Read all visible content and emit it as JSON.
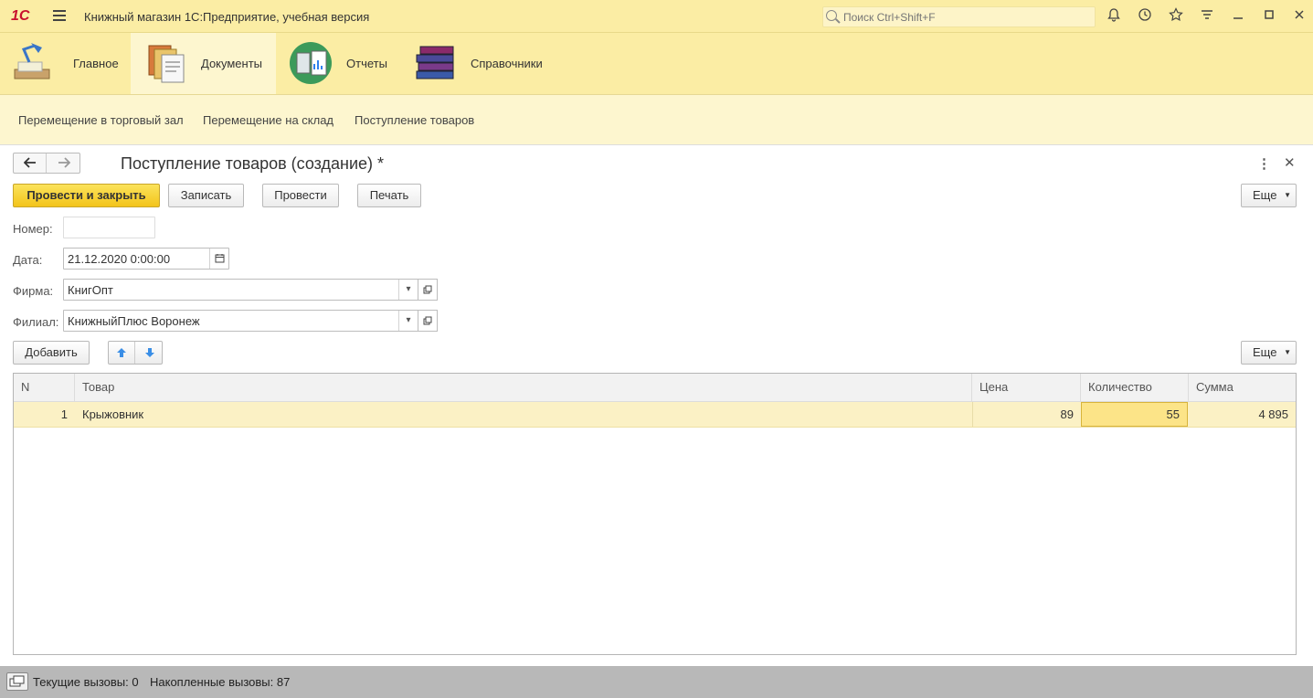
{
  "app": {
    "logo": "1С",
    "title": "Книжный магазин 1С:Предприятие, учебная версия",
    "search_placeholder": "Поиск Ctrl+Shift+F"
  },
  "sections": [
    {
      "label": "Главное",
      "icon": "desk-lamp-icon"
    },
    {
      "label": "Документы",
      "icon": "documents-icon",
      "active": true
    },
    {
      "label": "Отчеты",
      "icon": "reports-icon"
    },
    {
      "label": "Справочники",
      "icon": "books-icon"
    }
  ],
  "commands": [
    "Перемещение в торговый зал",
    "Перемещение на склад",
    "Поступление товаров"
  ],
  "form": {
    "title": "Поступление товаров (создание) *",
    "buttons": {
      "post_close": "Провести и закрыть",
      "save": "Записать",
      "post": "Провести",
      "print": "Печать",
      "more": "Еще"
    },
    "fields": {
      "number_label": "Номер:",
      "number_value": "",
      "date_label": "Дата:",
      "date_value": "21.12.2020  0:00:00",
      "firm_label": "Фирма:",
      "firm_value": "КнигОпт",
      "branch_label": "Филиал:",
      "branch_value": "КнижныйПлюс Воронеж"
    },
    "table_toolbar": {
      "add": "Добавить",
      "more": "Еще"
    },
    "table": {
      "columns": [
        "N",
        "Товар",
        "Цена",
        "Количество",
        "Сумма"
      ],
      "rows": [
        {
          "n": "1",
          "product": "Крыжовник",
          "price": "89",
          "qty": "55",
          "sum": "4 895"
        }
      ]
    }
  },
  "status": {
    "current_calls": "Текущие вызовы: 0",
    "accumulated_calls": "Накопленные вызовы: 87"
  },
  "colors": {
    "header_bg": "#fbeda4",
    "primary_button": "#f3c41b",
    "selected_row": "#fbf1c5"
  }
}
